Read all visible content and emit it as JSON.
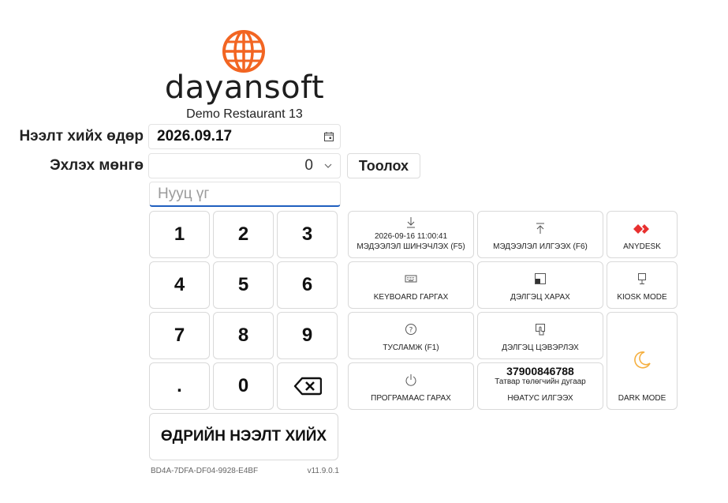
{
  "brand": {
    "name": "dayansoft",
    "restaurant": "Demo Restaurant 13"
  },
  "form": {
    "date_label": "Нээлт хийх өдөр",
    "date_value": "2026.09.17",
    "money_label": "Эхлэх мөнгө",
    "money_value": "0",
    "count_button": "Тоолох",
    "password_placeholder": "Нууц үг"
  },
  "keypad": {
    "keys": [
      "1",
      "2",
      "3",
      "4",
      "5",
      "6",
      "7",
      "8",
      "9",
      ".",
      "0"
    ],
    "open_day": "ӨДРИЙН НЭЭЛТ ХИЙХ"
  },
  "footer": {
    "device_id": "BD4A-7DFA-DF04-9928-E4BF",
    "version": "v11.9.0.1"
  },
  "tiles": {
    "sync_time": "2026-09-16 11:00:41",
    "sync": "МЭДЭЭЛЭЛ ШИНЭЧЛЭХ (F5)",
    "upload": "МЭДЭЭЛЭЛ ИЛГЭЭХ (F6)",
    "anydesk": "ANYDESK",
    "keyboard": "KEYBOARD ГАРГАХ",
    "screen_view": "ДЭЛГЭЦ ХАРАХ",
    "kiosk": "KIOSK MODE",
    "help": "ТУСЛАМЖ (F1)",
    "screen_clean": "ДЭЛГЭЦ ЦЭВЭРЛЭХ",
    "dark": "DARK MODE",
    "exit": "ПРОГРАМААС ГАРАХ",
    "phone": "37900846788",
    "phone_label": "Татвар төлөгчийн дугаар",
    "unsent": "НӨАТУС ИЛГЭЭХ"
  },
  "colors": {
    "accent": "#f26522",
    "focus": "#1f5fbf",
    "anydesk": "#e8302f",
    "moon": "#f5b041"
  }
}
